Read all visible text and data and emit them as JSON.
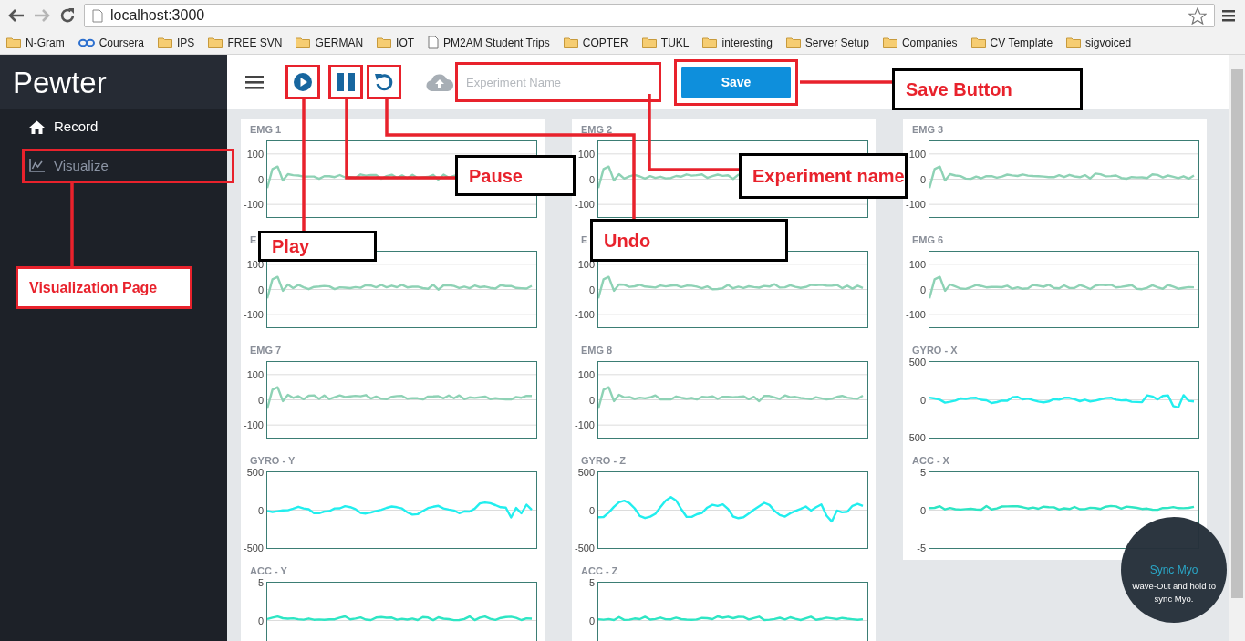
{
  "browser": {
    "nav_buttons": [
      {
        "kind": "back",
        "disabled": false
      },
      {
        "kind": "forward",
        "disabled": true
      },
      {
        "kind": "reload",
        "disabled": false
      }
    ],
    "url": "localhost:3000",
    "bookmarks": [
      {
        "label": "N-Gram",
        "kind": "folder"
      },
      {
        "label": "Coursera",
        "kind": "link"
      },
      {
        "label": "IPS",
        "kind": "folder"
      },
      {
        "label": "FREE SVN",
        "kind": "folder"
      },
      {
        "label": "GERMAN",
        "kind": "folder"
      },
      {
        "label": "IOT",
        "kind": "folder"
      },
      {
        "label": "PM2AM Student Trips",
        "kind": "page"
      },
      {
        "label": "COPTER",
        "kind": "folder"
      },
      {
        "label": "TUKL",
        "kind": "folder"
      },
      {
        "label": "interesting",
        "kind": "folder"
      },
      {
        "label": "Server Setup",
        "kind": "folder"
      },
      {
        "label": "Companies",
        "kind": "folder"
      },
      {
        "label": "CV Template",
        "kind": "folder"
      },
      {
        "label": "sigvoiced",
        "kind": "folder"
      }
    ]
  },
  "sidebar": {
    "title": "Pewter",
    "items": [
      {
        "label": "Record",
        "selected": true
      },
      {
        "label": "Visualize",
        "selected": false
      }
    ]
  },
  "toolbar": {
    "buttons": [
      {
        "kind": "play"
      },
      {
        "kind": "pause"
      },
      {
        "kind": "undo"
      }
    ],
    "experiment_name": {
      "placeholder": "Experiment Name"
    },
    "save": "Save"
  },
  "panels": [
    {
      "charts": [
        {
          "title": "EMG 1",
          "kind": "emg",
          "yticks": [
            "100",
            "0",
            "-100"
          ],
          "color": "#8ed2b5"
        },
        {
          "title": "E",
          "kind": "emg",
          "yticks": [
            "100",
            "0",
            "-100"
          ],
          "color": "#8ed2b5"
        },
        {
          "title": "EMG 7",
          "kind": "emg",
          "yticks": [
            "100",
            "0",
            "-100"
          ],
          "color": "#8ed2b5"
        },
        {
          "title": "GYRO - Y",
          "kind": "gyro",
          "yticks": [
            "500",
            "0",
            "-500"
          ],
          "color": "#22eeee"
        },
        {
          "title": "ACC - Y",
          "kind": "acc",
          "yticks": [
            "5",
            "0"
          ],
          "color": "#2ee6c4"
        }
      ]
    },
    {
      "charts": [
        {
          "title": "EMG 2",
          "kind": "emg",
          "yticks": [
            "100",
            "0",
            "-100"
          ],
          "color": "#8ed2b5"
        },
        {
          "title": "E",
          "kind": "emg",
          "yticks": [
            "100",
            "0",
            "-100"
          ],
          "color": "#8ed2b5"
        },
        {
          "title": "EMG 8",
          "kind": "emg",
          "yticks": [
            "100",
            "0",
            "-100"
          ],
          "color": "#8ed2b5"
        },
        {
          "title": "GYRO - Z",
          "kind": "gyro",
          "yticks": [
            "500",
            "0",
            "-500"
          ],
          "color": "#22eeee"
        },
        {
          "title": "ACC - Z",
          "kind": "acc",
          "yticks": [
            "5",
            "0"
          ],
          "color": "#2ee6c4"
        }
      ]
    },
    {
      "charts": [
        {
          "title": "EMG 3",
          "kind": "emg",
          "yticks": [
            "100",
            "0",
            "-100"
          ],
          "color": "#8ed2b5"
        },
        {
          "title": "EMG 6",
          "kind": "emg",
          "yticks": [
            "100",
            "0",
            "-100"
          ],
          "color": "#8ed2b5"
        },
        {
          "title": "GYRO - X",
          "kind": "gyro",
          "yticks": [
            "500",
            "0",
            "-500"
          ],
          "color": "#22eeee"
        },
        {
          "title": "ACC - X",
          "kind": "acc",
          "yticks": [
            "5",
            "0",
            "-5"
          ],
          "color": "#2ee6c4"
        }
      ]
    }
  ],
  "sync_popup": {
    "title": "Sync Myo",
    "message": "Wave-Out and hold to sync Myo."
  },
  "annotations": [
    {
      "label": "Save Button"
    },
    {
      "label": "Pause"
    },
    {
      "label": "Experiment name"
    },
    {
      "label": "Play"
    },
    {
      "label": "Undo"
    },
    {
      "label": "Visualization Page"
    }
  ]
}
